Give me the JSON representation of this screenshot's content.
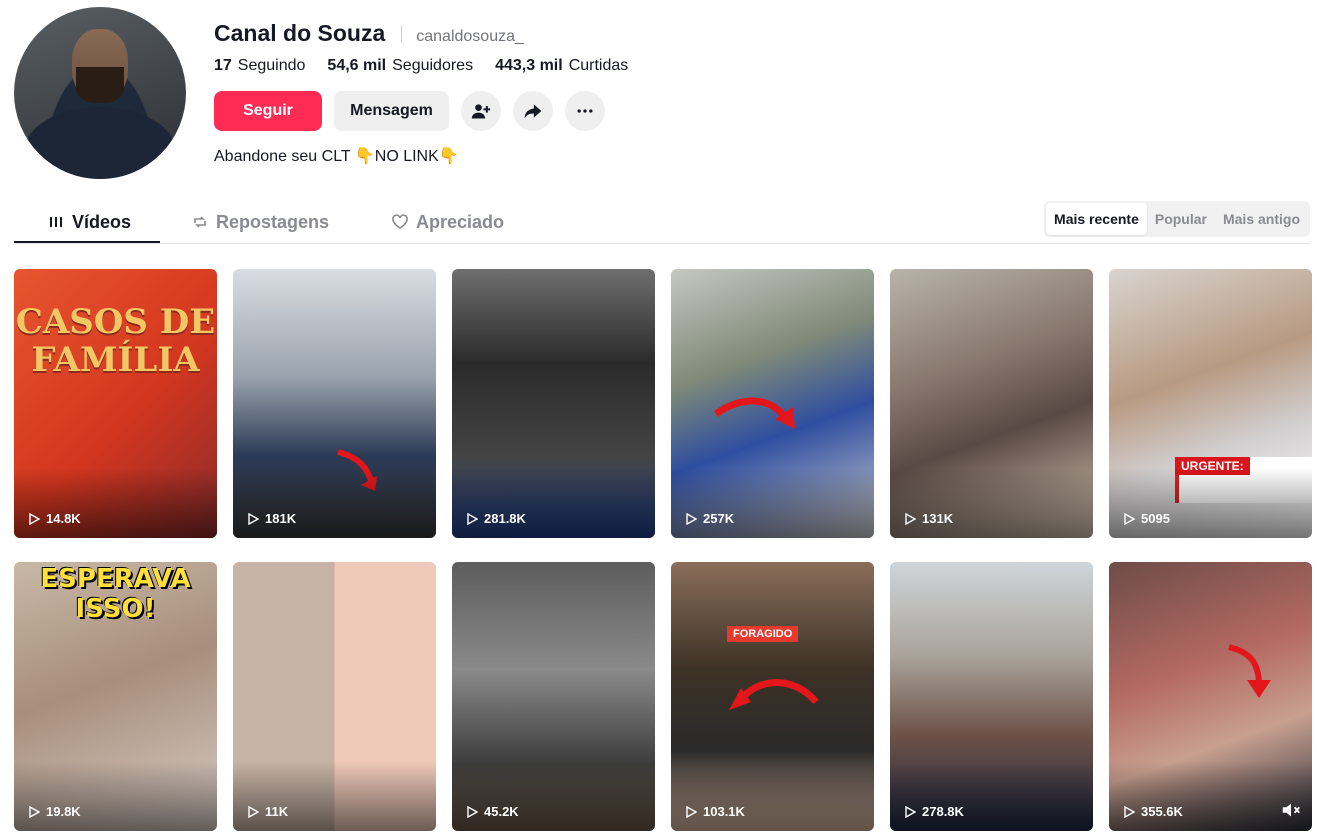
{
  "profile": {
    "display_name": "Canal do Souza",
    "username": "canaldosouza_",
    "stats": {
      "following_value": "17",
      "following_label": "Seguindo",
      "followers_value": "54,6 mil",
      "followers_label": "Seguidores",
      "likes_value": "443,3 mil",
      "likes_label": "Curtidas"
    },
    "actions": {
      "follow": "Seguir",
      "message": "Mensagem"
    },
    "bio": "Abandone seu CLT 👇NO LINK👇"
  },
  "tabs": {
    "videos": "Vídeos",
    "reposts": "Repostagens",
    "liked": "Apreciado"
  },
  "sort": {
    "options": [
      "Mais recente",
      "Popular",
      "Mais antigo"
    ],
    "selected": "Mais recente"
  },
  "videos": [
    {
      "views": "14.8K",
      "overlay": "CASOS DE FAMÍLIA"
    },
    {
      "views": "181K"
    },
    {
      "views": "281.8K"
    },
    {
      "views": "257K"
    },
    {
      "views": "131K"
    },
    {
      "views": "5095",
      "overlay": "URGENTE:"
    },
    {
      "views": "19.8K",
      "overlay": "ESPERAVA ISSO!"
    },
    {
      "views": "11K"
    },
    {
      "views": "45.2K"
    },
    {
      "views": "103.1K",
      "overlay": "FORAGIDO"
    },
    {
      "views": "278.8K"
    },
    {
      "views": "355.6K"
    }
  ],
  "colors": {
    "accent": "#fe2c55",
    "text": "#161823",
    "muted": "#73747b"
  }
}
